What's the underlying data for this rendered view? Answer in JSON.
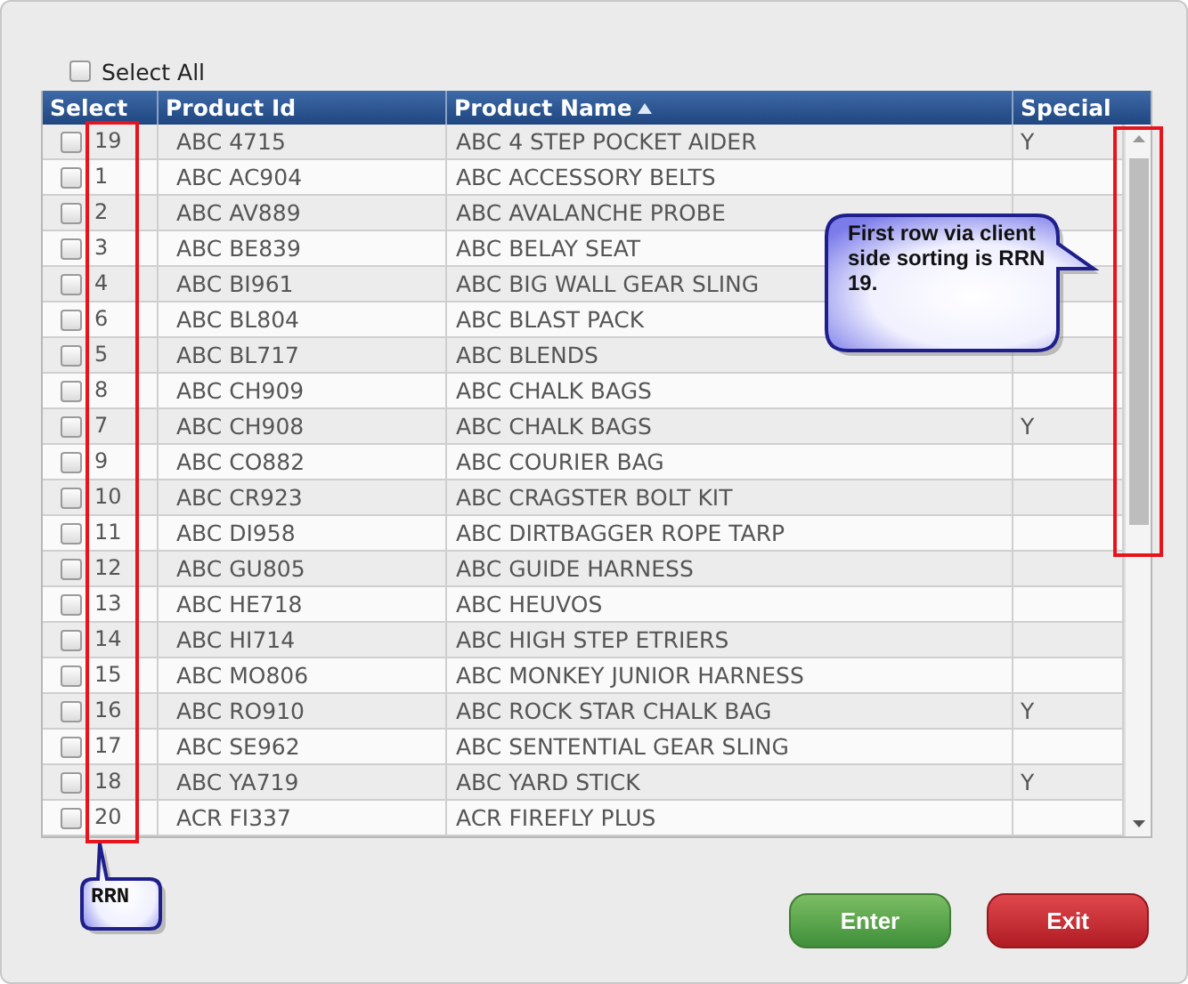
{
  "select_all": {
    "label": "Select All",
    "checked": false
  },
  "columns": [
    {
      "label": "Select",
      "sorted": false
    },
    {
      "label": "Product Id",
      "sorted": false
    },
    {
      "label": "Product Name",
      "sorted": true
    },
    {
      "label": "Special",
      "sorted": false
    }
  ],
  "rows": [
    {
      "checked": false,
      "rrn": "19",
      "product_id": "ABC 4715",
      "product_name": "ABC 4 STEP POCKET AIDER",
      "special": "Y"
    },
    {
      "checked": false,
      "rrn": "1",
      "product_id": "ABC AC904",
      "product_name": "ABC ACCESSORY BELTS",
      "special": ""
    },
    {
      "checked": false,
      "rrn": "2",
      "product_id": "ABC AV889",
      "product_name": "ABC AVALANCHE PROBE",
      "special": ""
    },
    {
      "checked": false,
      "rrn": "3",
      "product_id": "ABC BE839",
      "product_name": "ABC BELAY SEAT",
      "special": ""
    },
    {
      "checked": false,
      "rrn": "4",
      "product_id": "ABC BI961",
      "product_name": "ABC BIG WALL GEAR SLING",
      "special": ""
    },
    {
      "checked": false,
      "rrn": "6",
      "product_id": "ABC BL804",
      "product_name": "ABC BLAST PACK",
      "special": ""
    },
    {
      "checked": false,
      "rrn": "5",
      "product_id": "ABC BL717",
      "product_name": "ABC BLENDS",
      "special": ""
    },
    {
      "checked": false,
      "rrn": "8",
      "product_id": "ABC CH909",
      "product_name": "ABC CHALK BAGS",
      "special": ""
    },
    {
      "checked": false,
      "rrn": "7",
      "product_id": "ABC CH908",
      "product_name": "ABC CHALK BAGS",
      "special": "Y"
    },
    {
      "checked": false,
      "rrn": "9",
      "product_id": "ABC CO882",
      "product_name": "ABC COURIER BAG",
      "special": ""
    },
    {
      "checked": false,
      "rrn": "10",
      "product_id": "ABC CR923",
      "product_name": "ABC CRAGSTER BOLT KIT",
      "special": ""
    },
    {
      "checked": false,
      "rrn": "11",
      "product_id": "ABC DI958",
      "product_name": "ABC DIRTBAGGER ROPE TARP",
      "special": ""
    },
    {
      "checked": false,
      "rrn": "12",
      "product_id": "ABC GU805",
      "product_name": "ABC GUIDE HARNESS",
      "special": ""
    },
    {
      "checked": false,
      "rrn": "13",
      "product_id": "ABC HE718",
      "product_name": "ABC HEUVOS",
      "special": ""
    },
    {
      "checked": false,
      "rrn": "14",
      "product_id": "ABC HI714",
      "product_name": "ABC HIGH STEP ETRIERS",
      "special": ""
    },
    {
      "checked": false,
      "rrn": "15",
      "product_id": "ABC MO806",
      "product_name": "ABC MONKEY JUNIOR HARNESS",
      "special": ""
    },
    {
      "checked": false,
      "rrn": "16",
      "product_id": "ABC RO910",
      "product_name": "ABC ROCK STAR CHALK BAG",
      "special": "Y"
    },
    {
      "checked": false,
      "rrn": "17",
      "product_id": "ABC SE962",
      "product_name": "ABC SENTENTIAL GEAR SLING",
      "special": ""
    },
    {
      "checked": false,
      "rrn": "18",
      "product_id": "ABC YA719",
      "product_name": "ABC YARD STICK",
      "special": "Y"
    },
    {
      "checked": false,
      "rrn": "20",
      "product_id": "ACR FI337",
      "product_name": "ACR FIREFLY PLUS",
      "special": ""
    }
  ],
  "buttons": [
    {
      "kind": "enter",
      "label": "Enter"
    },
    {
      "kind": "exit",
      "label": "Exit"
    }
  ],
  "callouts": [
    {
      "kind": "side",
      "text": "First row via client side sorting is RRN 19."
    },
    {
      "kind": "below",
      "text": "RRN"
    }
  ]
}
